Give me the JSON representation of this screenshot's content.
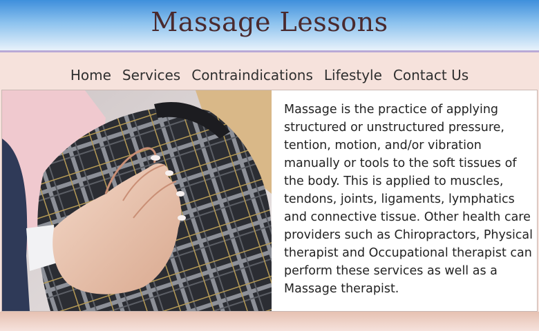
{
  "header": {
    "title": "Massage Lessons"
  },
  "nav": {
    "items": [
      {
        "label": "Home"
      },
      {
        "label": "Services"
      },
      {
        "label": "Contraindications"
      },
      {
        "label": "Lifestyle"
      },
      {
        "label": "Contact Us"
      }
    ]
  },
  "main": {
    "body_text": "Massage is the practice of applying structured or unstructured pressure, tention, motion, and/or vibration manually or tools to the soft tissues of the body. This is applied to muscles, tendons, joints, ligaments, lymphatics and connective tissue. Other health care providers such as Chiropractors, Physical therapist and Occupational therapist can perform these services as well as a Massage therapist."
  }
}
